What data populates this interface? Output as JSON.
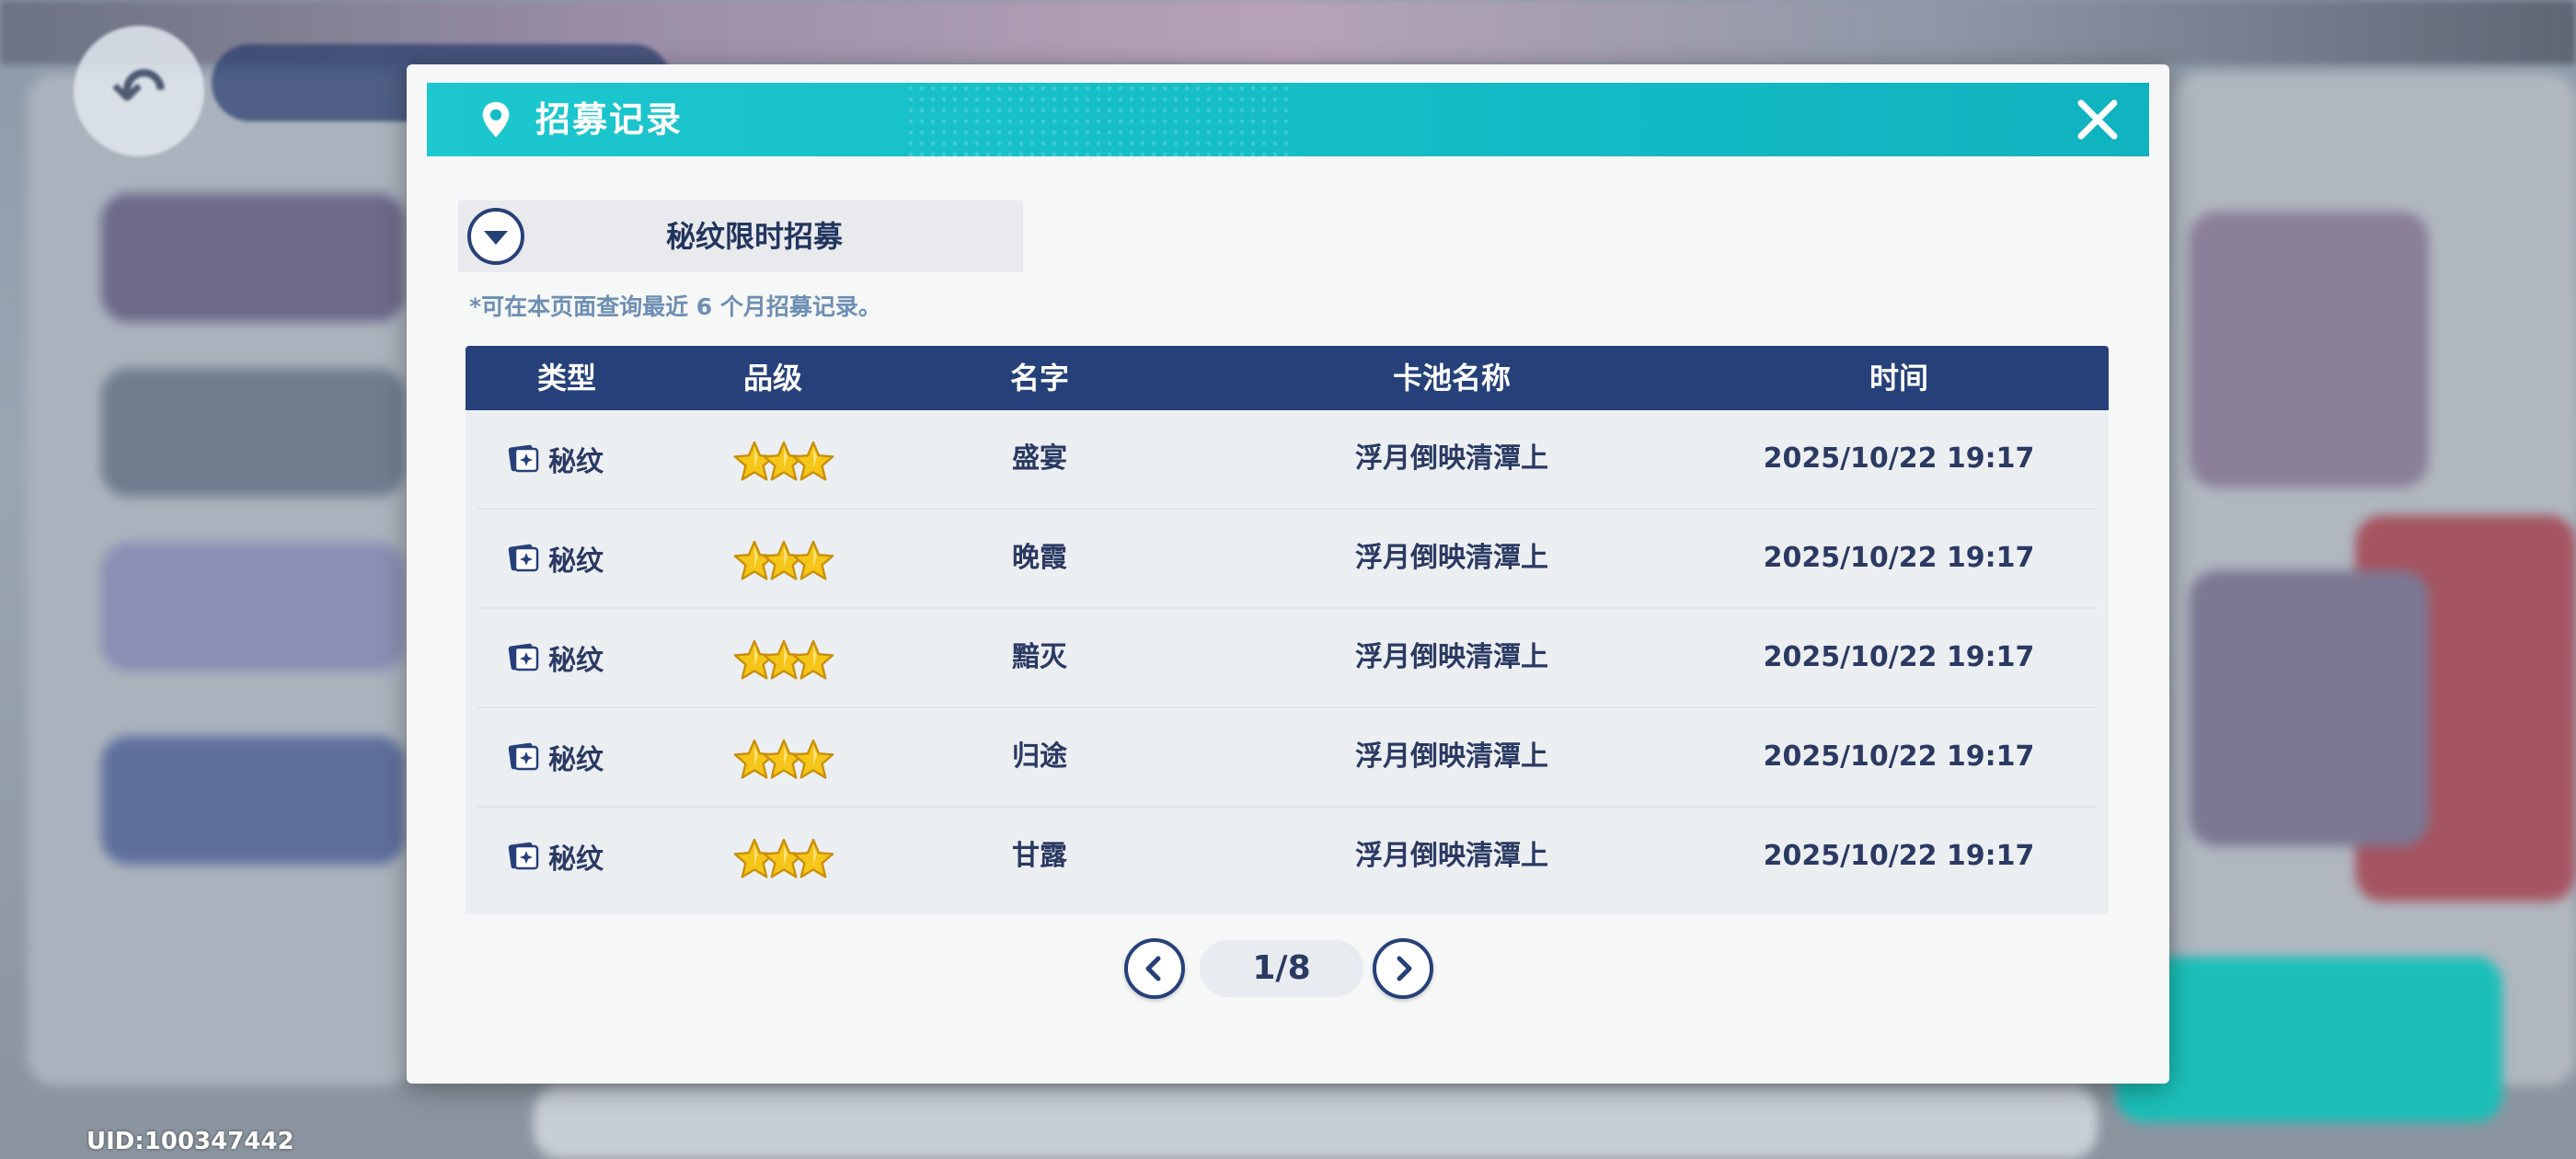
{
  "background": {
    "uid_text": "UID:100347442"
  },
  "dialog": {
    "title": "招募记录",
    "pool_selector": {
      "selected": "秘纹限时招募"
    },
    "notice": "*可在本页面查询最近 6 个月招募记录。",
    "table": {
      "columns": [
        "类型",
        "品级",
        "名字",
        "卡池名称",
        "时间"
      ],
      "rows": [
        {
          "type": "秘纹",
          "rarity_stars": 3,
          "name": "盛宴",
          "pool": "浮月倒映清潭上",
          "time": "2025/10/22 19:17"
        },
        {
          "type": "秘纹",
          "rarity_stars": 3,
          "name": "晚霞",
          "pool": "浮月倒映清潭上",
          "time": "2025/10/22 19:17"
        },
        {
          "type": "秘纹",
          "rarity_stars": 3,
          "name": "黯灭",
          "pool": "浮月倒映清潭上",
          "time": "2025/10/22 19:17"
        },
        {
          "type": "秘纹",
          "rarity_stars": 3,
          "name": "归途",
          "pool": "浮月倒映清潭上",
          "time": "2025/10/22 19:17"
        },
        {
          "type": "秘纹",
          "rarity_stars": 3,
          "name": "甘露",
          "pool": "浮月倒映清潭上",
          "time": "2025/10/22 19:17"
        }
      ]
    },
    "pagination": {
      "label": "1/8"
    }
  },
  "colors": {
    "header_teal": "#14bcc6",
    "table_header_navy": "#26417a",
    "text_navy": "#2b3a63",
    "notice_blue": "#6e8fb3",
    "star_gold": "#f5c518"
  },
  "icons": {
    "header": "location-pin-icon",
    "close": "close-icon",
    "dropdown": "chevron-down-icon",
    "type": "card-icon",
    "rarity": "star-icon",
    "prev": "chevron-left-icon",
    "next": "chevron-right-icon"
  }
}
